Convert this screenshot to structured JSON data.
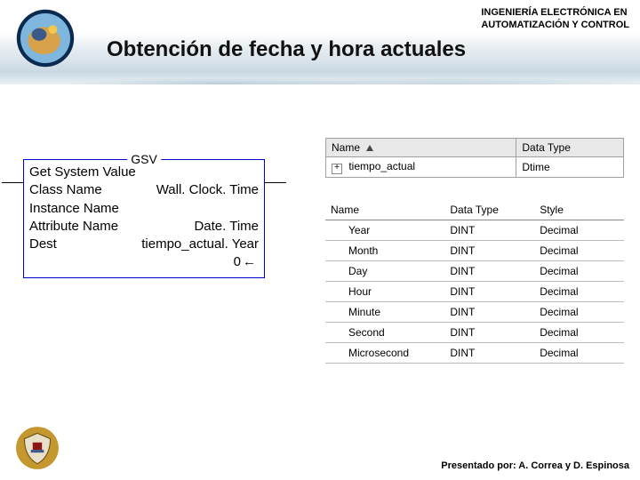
{
  "header": {
    "dept_line1": "INGENIERÍA ELECTRÓNICA EN",
    "dept_line2": "AUTOMATIZACIÓN Y CONTROL",
    "title": "Obtención de fecha y hora actuales"
  },
  "gsv": {
    "legend": "GSV",
    "row1": "Get System Value",
    "class_name_lbl": "Class Name",
    "class_name_val": "Wall. Clock. Time",
    "instance_name_lbl": "Instance Name",
    "attribute_name_lbl": "Attribute Name",
    "attribute_name_val": "Date. Time",
    "dest_lbl": "Dest",
    "dest_val": "tiempo_actual. Year",
    "zero": "0",
    "arrow": "←"
  },
  "table1": {
    "col_name": "Name",
    "col_dtype": "Data Type",
    "row_name": "tiempo_actual",
    "row_dtype": "Dtime"
  },
  "table2": {
    "col_name": "Name",
    "col_dtype": "Data Type",
    "col_style": "Style",
    "rows": [
      {
        "name": "Year",
        "dtype": "DINT",
        "style": "Decimal"
      },
      {
        "name": "Month",
        "dtype": "DINT",
        "style": "Decimal"
      },
      {
        "name": "Day",
        "dtype": "DINT",
        "style": "Decimal"
      },
      {
        "name": "Hour",
        "dtype": "DINT",
        "style": "Decimal"
      },
      {
        "name": "Minute",
        "dtype": "DINT",
        "style": "Decimal"
      },
      {
        "name": "Second",
        "dtype": "DINT",
        "style": "Decimal"
      },
      {
        "name": "Microsecond",
        "dtype": "DINT",
        "style": "Decimal"
      }
    ]
  },
  "footer": {
    "text": "Presentado por: A. Correa y D. Espinosa"
  }
}
